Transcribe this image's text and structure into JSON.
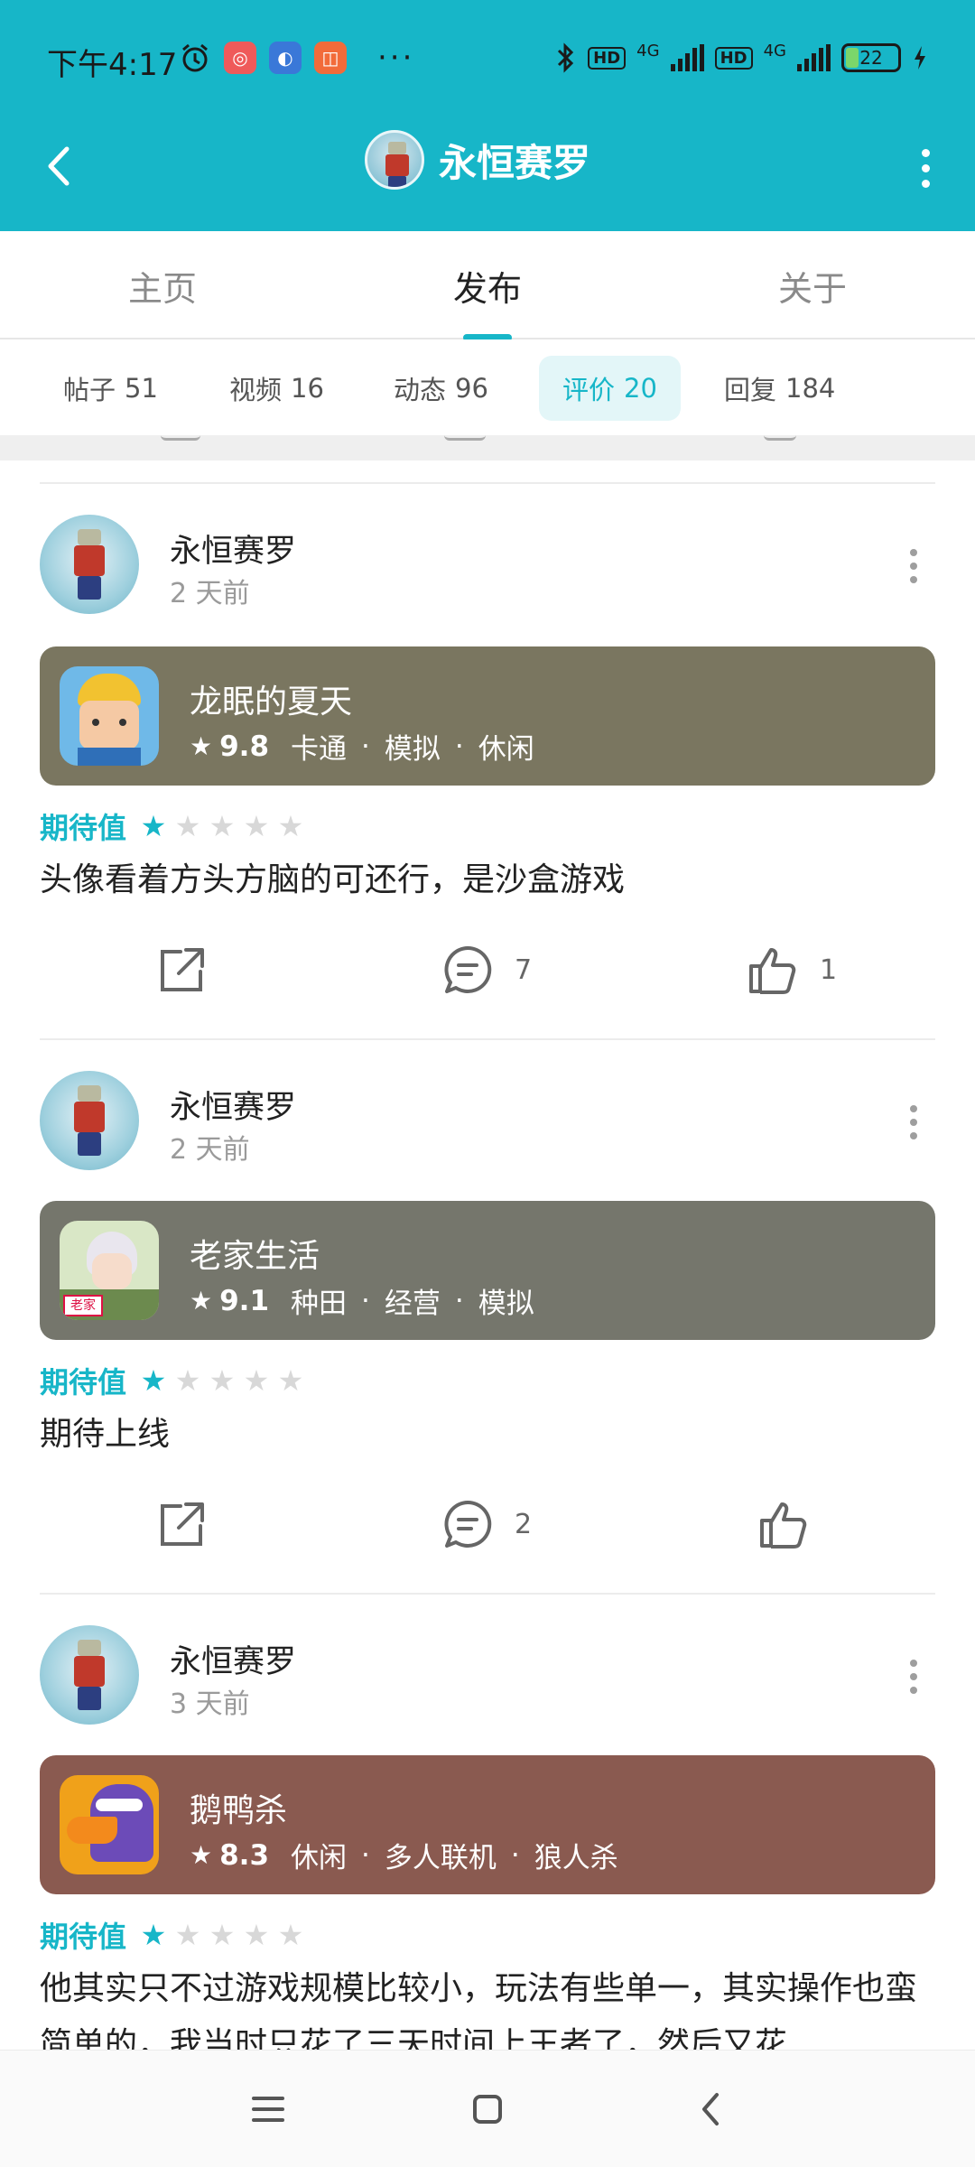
{
  "status": {
    "time": "下午4:17",
    "battery": "22",
    "net1": "4G",
    "net2": "4G",
    "hd": "HD",
    "more": "···"
  },
  "header": {
    "title": "永恒赛罗"
  },
  "main_tabs": [
    {
      "label": "主页"
    },
    {
      "label": "发布"
    },
    {
      "label": "关于"
    }
  ],
  "sub_tabs": [
    {
      "label": "帖子",
      "count": "51"
    },
    {
      "label": "视频",
      "count": "16"
    },
    {
      "label": "动态",
      "count": "96"
    },
    {
      "label": "评价",
      "count": "20"
    },
    {
      "label": "回复",
      "count": "184"
    }
  ],
  "posts": [
    {
      "user": "永恒赛罗",
      "time": "2 天前",
      "game": {
        "name": "龙眠的夏天",
        "star": "★",
        "score": "9.8",
        "tags": [
          "卡通",
          "模拟",
          "休闲"
        ],
        "color": "#7a7660"
      },
      "expect_label": "期待值",
      "rating": 1,
      "content": "头像看着方头方脑的可还行，是沙盒游戏",
      "comments": "7",
      "likes": "1"
    },
    {
      "user": "永恒赛罗",
      "time": "2 天前",
      "game": {
        "name": "老家生活",
        "star": "★",
        "score": "9.1",
        "tags": [
          "种田",
          "经营",
          "模拟"
        ],
        "color": "#75766c"
      },
      "expect_label": "期待值",
      "rating": 1,
      "content": "期待上线",
      "comments": "2",
      "likes": ""
    },
    {
      "user": "永恒赛罗",
      "time": "3 天前",
      "game": {
        "name": "鹅鸭杀",
        "star": "★",
        "score": "8.3",
        "tags": [
          "休闲",
          "多人联机",
          "狼人杀"
        ],
        "color": "#8a5a50"
      },
      "expect_label": "期待值",
      "rating": 1,
      "content": "他其实只不过游戏规模比较小，玩法有些单一，其实操作也蛮简单的，我当时只花了三天时间上王者了，然后又花",
      "comments": "",
      "likes": ""
    }
  ],
  "theme": {
    "accent": "#17b6c8"
  },
  "icons": {
    "back": "back-arrow-icon",
    "more": "more-vertical-icon",
    "share": "share-icon",
    "comment": "comment-icon",
    "like": "thumbs-up-icon",
    "nav_menu": "menu-icon",
    "nav_home": "home-square-icon",
    "nav_back": "nav-back-icon"
  }
}
